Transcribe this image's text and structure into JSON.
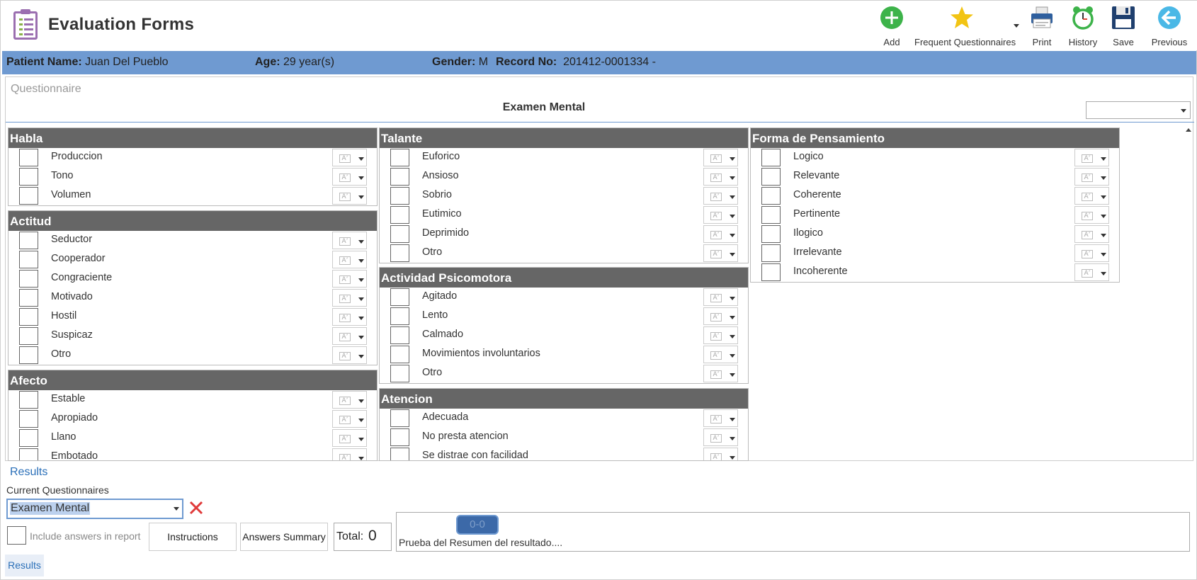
{
  "app": {
    "title": "Evaluation Forms"
  },
  "toolbar": {
    "add": "Add",
    "frequent": "Frequent Questionnaires",
    "print": "Print",
    "history": "History",
    "save": "Save",
    "previous": "Previous"
  },
  "patient": {
    "name_label": "Patient Name:",
    "name": "Juan Del Pueblo",
    "age_label": "Age:",
    "age": "29 year(s)",
    "gender_label": "Gender:",
    "gender": "M",
    "record_label": "Record No:",
    "record": "201412-0001334 -"
  },
  "questionnaire": {
    "label": "Questionnaire",
    "name": "Examen Mental",
    "select_value": ""
  },
  "sections": {
    "habla": {
      "title": "Habla",
      "items": [
        "Produccion",
        "Tono",
        "Volumen"
      ]
    },
    "actitud": {
      "title": "Actitud",
      "items": [
        "Seductor",
        "Cooperador",
        "Congraciente",
        "Motivado",
        "Hostil",
        "Suspicaz",
        "Otro"
      ]
    },
    "afecto": {
      "title": "Afecto",
      "items": [
        "Estable",
        "Apropiado",
        "Llano",
        "Embotado"
      ]
    },
    "talante": {
      "title": "Talante",
      "items": [
        "Euforico",
        "Ansioso",
        "Sobrio",
        "Eutimico",
        "Deprimido",
        "Otro"
      ]
    },
    "actividad": {
      "title": "Actividad Psicomotora",
      "items": [
        "Agitado",
        "Lento",
        "Calmado",
        "Movimientos involuntarios",
        "Otro"
      ]
    },
    "atencion": {
      "title": "Atencion",
      "items": [
        "Adecuada",
        "No presta atencion",
        "Se distrae con facilidad"
      ]
    },
    "forma": {
      "title": "Forma de Pensamiento",
      "items": [
        "Logico",
        "Relevante",
        "Coherente",
        "Pertinente",
        "Ilogico",
        "Irrelevante",
        "Incoherente"
      ]
    }
  },
  "results": {
    "link": "Results",
    "current_label": "Current Questionnaires",
    "current_value": "Examen Mental",
    "include_label": "Include answers in report",
    "instructions": "Instructions",
    "answers_summary": "Answers Summary",
    "total_label": "Total:",
    "total_value": "0",
    "score": "0-0",
    "summary_text": "Prueba del Resumen del resultado...."
  },
  "bottom_tab": "Results",
  "icons": {
    "add": "plus-circle-icon",
    "frequent": "star-icon",
    "print": "printer-icon",
    "history": "alarm-clock-icon",
    "save": "floppy-disk-icon",
    "previous": "arrow-left-circle-icon"
  },
  "colors": {
    "accent": "#6f9ad1",
    "section_header": "#666666",
    "link": "#2a6fb8",
    "add": "#3db34a",
    "star": "#f2c414"
  }
}
